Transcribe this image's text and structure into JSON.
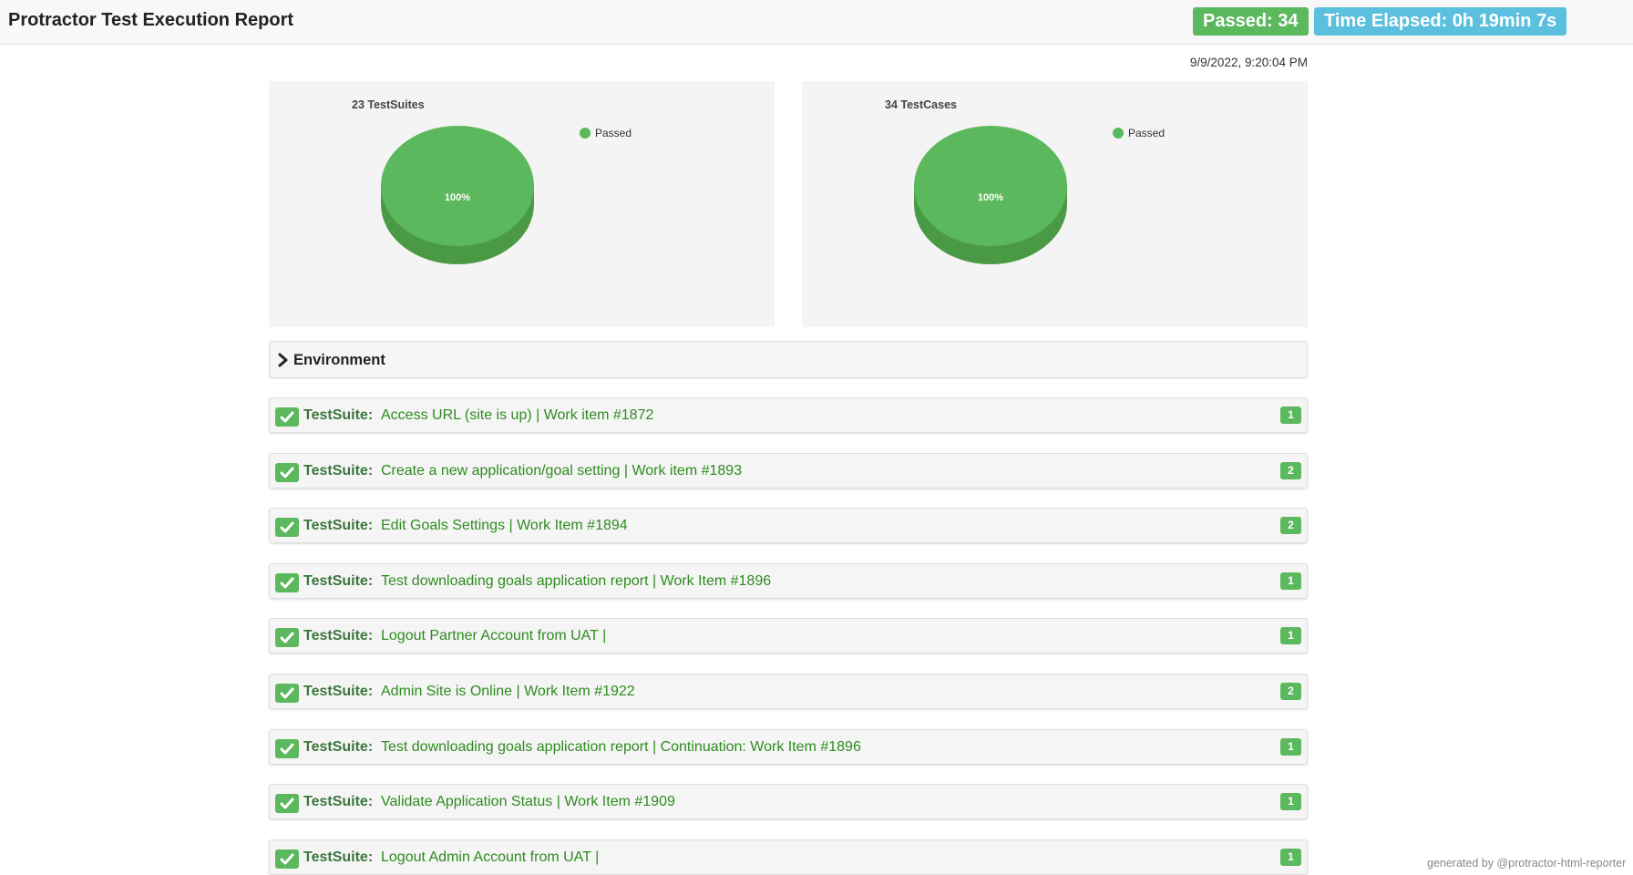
{
  "header": {
    "title": "Protractor Test Execution Report",
    "passed_badge": "Passed: 34",
    "time_badge": "Time Elapsed: 0h 19min 7s"
  },
  "timestamp": "9/9/2022, 9:20:04 PM",
  "colors": {
    "passed": "#5cb85c",
    "info": "#5bc0de",
    "suite_text": "#3c763d"
  },
  "chart_data": [
    {
      "type": "pie",
      "title": "23 TestSuites",
      "legend": [
        "Passed"
      ],
      "legend_position": "top-right",
      "slices": [
        {
          "label": "Passed",
          "value": 100,
          "display": "100%"
        }
      ]
    },
    {
      "type": "pie",
      "title": "34 TestCases",
      "legend": [
        "Passed"
      ],
      "legend_position": "top-right",
      "slices": [
        {
          "label": "Passed",
          "value": 100,
          "display": "100%"
        }
      ]
    }
  ],
  "environment": {
    "label": "Environment",
    "icon": "chevron-right-icon"
  },
  "suites": [
    {
      "prefix": "TestSuite:",
      "name": "Access URL (site is up) | Work item #1872",
      "count": "1"
    },
    {
      "prefix": "TestSuite:",
      "name": "Create a new application/goal setting | Work item #1893",
      "count": "2"
    },
    {
      "prefix": "TestSuite:",
      "name": "Edit Goals Settings | Work Item #1894",
      "count": "2"
    },
    {
      "prefix": "TestSuite:",
      "name": "Test downloading goals application report | Work Item #1896",
      "count": "1"
    },
    {
      "prefix": "TestSuite:",
      "name": "Logout Partner Account from UAT |",
      "count": "1"
    },
    {
      "prefix": "TestSuite:",
      "name": "Admin Site is Online | Work Item #1922",
      "count": "2"
    },
    {
      "prefix": "TestSuite:",
      "name": "Test downloading goals application report | Continuation: Work Item #1896",
      "count": "1"
    },
    {
      "prefix": "TestSuite:",
      "name": "Validate Application Status | Work Item #1909",
      "count": "1"
    },
    {
      "prefix": "TestSuite:",
      "name": "Logout Admin Account from UAT |",
      "count": "1"
    }
  ],
  "footer": "generated by @protractor-html-reporter"
}
